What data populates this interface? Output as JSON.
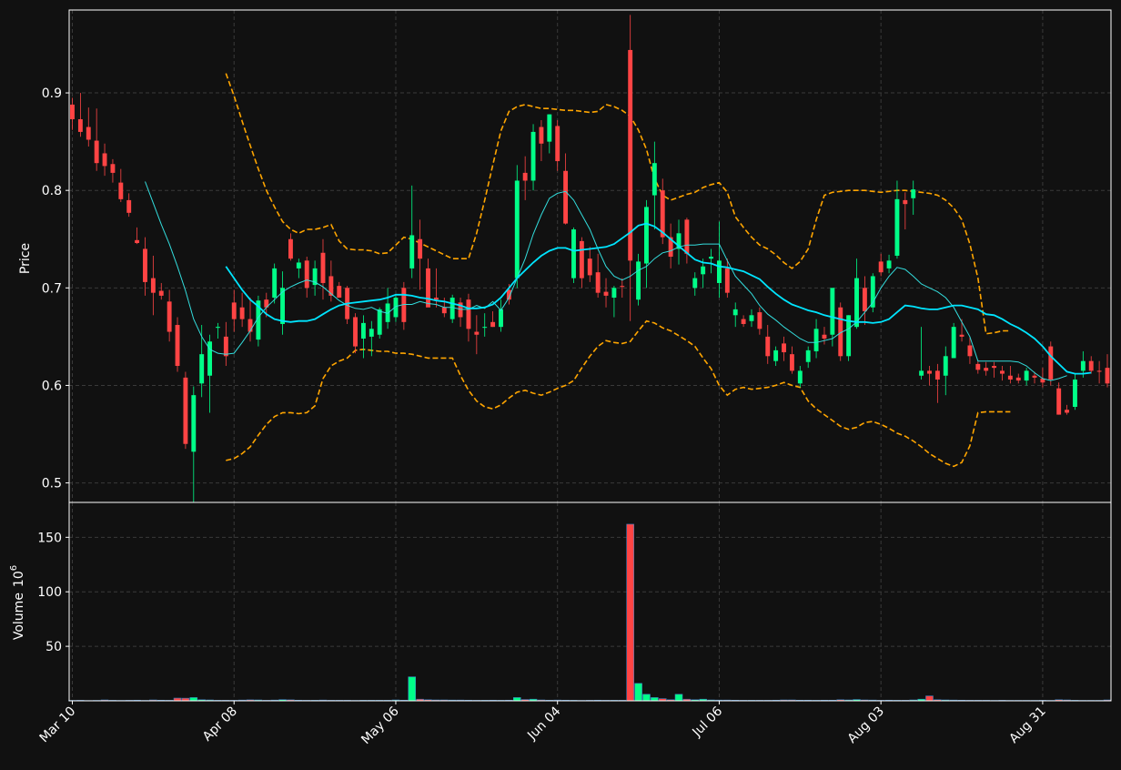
{
  "chart_data": {
    "type": "candlestick",
    "colors": {
      "background": "#111111",
      "up": "#00ff88",
      "down": "#ff4444",
      "ma_fast": "#33dddd",
      "ma_slow": "#00e5ff",
      "bands": "#ffa500",
      "grid": "#3a3a3a",
      "axes": "#ffffff",
      "volume_edge": "#3f7fbf"
    },
    "price_panel": {
      "ylabel": "Price",
      "ylim": [
        0.48,
        0.985
      ],
      "yticks": [
        0.5,
        0.6,
        0.7,
        0.8,
        0.9
      ],
      "ytick_labels": [
        "0.5",
        "0.6",
        "0.7",
        "0.8",
        "0.9"
      ],
      "grid": true
    },
    "volume_panel": {
      "ylabel": "Volume",
      "ylabel_exponent": "10",
      "ylabel_exponent_power": "6",
      "ylim": [
        0,
        182
      ],
      "yticks": [
        50,
        100,
        150
      ],
      "ytick_labels": [
        "50",
        "100",
        "150"
      ],
      "grid": true
    },
    "x_axis": {
      "tick_indices": [
        0,
        20,
        40,
        60,
        80,
        100,
        120
      ],
      "tick_labels": [
        "Mar 10",
        "Apr 08",
        "May 06",
        "Jun 04",
        "Jul 06",
        "Aug 03",
        "Aug 31"
      ]
    },
    "candles": [
      [
        0.888,
        0.895,
        0.862,
        0.873
      ],
      [
        0.873,
        0.9,
        0.855,
        0.86
      ],
      [
        0.865,
        0.885,
        0.845,
        0.852
      ],
      [
        0.851,
        0.884,
        0.82,
        0.828
      ],
      [
        0.838,
        0.848,
        0.815,
        0.825
      ],
      [
        0.827,
        0.832,
        0.808,
        0.818
      ],
      [
        0.808,
        0.822,
        0.788,
        0.791
      ],
      [
        0.79,
        0.797,
        0.773,
        0.777
      ],
      [
        0.749,
        0.762,
        0.745,
        0.746
      ],
      [
        0.74,
        0.752,
        0.692,
        0.706
      ],
      [
        0.71,
        0.733,
        0.672,
        0.695
      ],
      [
        0.697,
        0.705,
        0.688,
        0.692
      ],
      [
        0.686,
        0.698,
        0.645,
        0.655
      ],
      [
        0.662,
        0.67,
        0.614,
        0.62
      ],
      [
        0.608,
        0.614,
        0.535,
        0.54
      ],
      [
        0.532,
        0.599,
        0.48,
        0.59
      ],
      [
        0.602,
        0.662,
        0.588,
        0.632
      ],
      [
        0.61,
        0.652,
        0.572,
        0.645
      ],
      [
        0.66,
        0.664,
        0.648,
        0.66
      ],
      [
        0.65,
        0.665,
        0.62,
        0.63
      ],
      [
        0.685,
        0.698,
        0.655,
        0.668
      ],
      [
        0.68,
        0.695,
        0.66,
        0.668
      ],
      [
        0.668,
        0.69,
        0.645,
        0.655
      ],
      [
        0.647,
        0.692,
        0.64,
        0.687
      ],
      [
        0.688,
        0.695,
        0.67,
        0.68
      ],
      [
        0.69,
        0.725,
        0.684,
        0.72
      ],
      [
        0.663,
        0.717,
        0.652,
        0.7
      ],
      [
        0.75,
        0.756,
        0.728,
        0.73
      ],
      [
        0.72,
        0.73,
        0.71,
        0.726
      ],
      [
        0.728,
        0.732,
        0.69,
        0.7
      ],
      [
        0.703,
        0.728,
        0.692,
        0.72
      ],
      [
        0.736,
        0.75,
        0.688,
        0.705
      ],
      [
        0.712,
        0.728,
        0.686,
        0.692
      ],
      [
        0.702,
        0.706,
        0.694,
        0.69
      ],
      [
        0.7,
        0.702,
        0.663,
        0.668
      ],
      [
        0.67,
        0.674,
        0.633,
        0.64
      ],
      [
        0.648,
        0.672,
        0.628,
        0.664
      ],
      [
        0.65,
        0.666,
        0.63,
        0.658
      ],
      [
        0.652,
        0.68,
        0.648,
        0.678
      ],
      [
        0.665,
        0.7,
        0.658,
        0.684
      ],
      [
        0.67,
        0.692,
        0.665,
        0.69
      ],
      [
        0.7,
        0.706,
        0.657,
        0.665
      ],
      [
        0.72,
        0.805,
        0.71,
        0.754
      ],
      [
        0.75,
        0.77,
        0.698,
        0.73
      ],
      [
        0.72,
        0.73,
        0.695,
        0.68
      ],
      [
        0.69,
        0.72,
        0.68,
        0.688
      ],
      [
        0.68,
        0.69,
        0.67,
        0.674
      ],
      [
        0.668,
        0.693,
        0.664,
        0.69
      ],
      [
        0.685,
        0.69,
        0.66,
        0.67
      ],
      [
        0.688,
        0.694,
        0.645,
        0.658
      ],
      [
        0.655,
        0.672,
        0.632,
        0.652
      ],
      [
        0.66,
        0.674,
        0.65,
        0.66
      ],
      [
        0.665,
        0.676,
        0.66,
        0.66
      ],
      [
        0.66,
        0.688,
        0.655,
        0.678
      ],
      [
        0.698,
        0.704,
        0.683,
        0.688
      ],
      [
        0.71,
        0.826,
        0.7,
        0.81
      ],
      [
        0.818,
        0.835,
        0.79,
        0.81
      ],
      [
        0.81,
        0.868,
        0.8,
        0.86
      ],
      [
        0.865,
        0.872,
        0.83,
        0.848
      ],
      [
        0.85,
        0.878,
        0.838,
        0.878
      ],
      [
        0.866,
        0.872,
        0.82,
        0.83
      ],
      [
        0.82,
        0.838,
        0.765,
        0.766
      ],
      [
        0.71,
        0.762,
        0.705,
        0.76
      ],
      [
        0.748,
        0.752,
        0.7,
        0.71
      ],
      [
        0.73,
        0.742,
        0.706,
        0.713
      ],
      [
        0.716,
        0.735,
        0.69,
        0.695
      ],
      [
        0.696,
        0.71,
        0.68,
        0.692
      ],
      [
        0.69,
        0.702,
        0.67,
        0.7
      ],
      [
        0.702,
        0.71,
        0.69,
        0.701
      ],
      [
        0.944,
        0.98,
        0.666,
        0.728
      ],
      [
        0.688,
        0.735,
        0.682,
        0.727
      ],
      [
        0.725,
        0.79,
        0.7,
        0.783
      ],
      [
        0.795,
        0.85,
        0.76,
        0.828
      ],
      [
        0.8,
        0.812,
        0.745,
        0.752
      ],
      [
        0.752,
        0.766,
        0.72,
        0.732
      ],
      [
        0.74,
        0.77,
        0.724,
        0.756
      ],
      [
        0.77,
        0.772,
        0.725,
        0.735
      ],
      [
        0.7,
        0.716,
        0.692,
        0.71
      ],
      [
        0.714,
        0.73,
        0.7,
        0.722
      ],
      [
        0.73,
        0.74,
        0.715,
        0.732
      ],
      [
        0.705,
        0.768,
        0.69,
        0.728
      ],
      [
        0.72,
        0.73,
        0.69,
        0.695
      ],
      [
        0.672,
        0.685,
        0.66,
        0.678
      ],
      [
        0.668,
        0.672,
        0.66,
        0.663
      ],
      [
        0.666,
        0.678,
        0.66,
        0.672
      ],
      [
        0.675,
        0.68,
        0.652,
        0.658
      ],
      [
        0.65,
        0.662,
        0.622,
        0.63
      ],
      [
        0.625,
        0.64,
        0.62,
        0.636
      ],
      [
        0.643,
        0.65,
        0.625,
        0.634
      ],
      [
        0.632,
        0.64,
        0.612,
        0.615
      ],
      [
        0.602,
        0.62,
        0.598,
        0.615
      ],
      [
        0.624,
        0.64,
        0.618,
        0.636
      ],
      [
        0.635,
        0.668,
        0.628,
        0.658
      ],
      [
        0.652,
        0.66,
        0.642,
        0.648
      ],
      [
        0.652,
        0.7,
        0.64,
        0.7
      ],
      [
        0.68,
        0.685,
        0.625,
        0.63
      ],
      [
        0.63,
        0.672,
        0.625,
        0.672
      ],
      [
        0.66,
        0.73,
        0.658,
        0.71
      ],
      [
        0.7,
        0.712,
        0.662,
        0.676
      ],
      [
        0.68,
        0.715,
        0.675,
        0.712
      ],
      [
        0.727,
        0.735,
        0.712,
        0.716
      ],
      [
        0.72,
        0.734,
        0.715,
        0.728
      ],
      [
        0.733,
        0.81,
        0.73,
        0.791
      ],
      [
        0.79,
        0.798,
        0.76,
        0.786
      ],
      [
        0.792,
        0.81,
        0.775,
        0.801
      ],
      [
        0.61,
        0.66,
        0.606,
        0.615
      ],
      [
        0.615,
        0.62,
        0.6,
        0.612
      ],
      [
        0.615,
        0.622,
        0.582,
        0.606
      ],
      [
        0.61,
        0.64,
        0.59,
        0.63
      ],
      [
        0.628,
        0.664,
        0.628,
        0.66
      ],
      [
        0.652,
        0.668,
        0.645,
        0.65
      ],
      [
        0.641,
        0.65,
        0.622,
        0.63
      ],
      [
        0.622,
        0.626,
        0.612,
        0.616
      ],
      [
        0.618,
        0.624,
        0.61,
        0.615
      ],
      [
        0.62,
        0.624,
        0.608,
        0.618
      ],
      [
        0.615,
        0.62,
        0.605,
        0.612
      ],
      [
        0.61,
        0.62,
        0.602,
        0.606
      ],
      [
        0.608,
        0.612,
        0.602,
        0.605
      ],
      [
        0.605,
        0.618,
        0.6,
        0.615
      ],
      [
        0.61,
        0.614,
        0.602,
        0.608
      ],
      [
        0.607,
        0.618,
        0.598,
        0.603
      ],
      [
        0.64,
        0.645,
        0.6,
        0.606
      ],
      [
        0.597,
        0.603,
        0.57,
        0.57
      ],
      [
        0.575,
        0.58,
        0.57,
        0.572
      ],
      [
        0.578,
        0.612,
        0.575,
        0.606
      ],
      [
        0.615,
        0.635,
        0.608,
        0.625
      ],
      [
        0.625,
        0.63,
        0.612,
        0.615
      ],
      [
        0.615,
        0.625,
        0.602,
        0.614
      ],
      [
        0.618,
        0.632,
        0.598,
        0.602
      ]
    ],
    "volume": [
      0.4,
      0.5,
      0.3,
      0.4,
      0.8,
      0.5,
      0.4,
      0.5,
      0.6,
      0.4,
      0.8,
      0.6,
      0.5,
      2.5,
      2.4,
      3.0,
      1.0,
      0.8,
      0.5,
      0.5,
      0.5,
      0.7,
      0.9,
      0.8,
      0.5,
      0.7,
      1.1,
      0.9,
      0.6,
      0.5,
      0.5,
      0.7,
      0.5,
      0.5,
      0.5,
      0.4,
      0.5,
      0.5,
      0.5,
      0.5,
      0.8,
      0.6,
      22,
      1.5,
      1.0,
      0.8,
      0.8,
      0.7,
      0.7,
      0.6,
      0.5,
      0.5,
      0.6,
      0.5,
      0.6,
      3.0,
      1.2,
      1.5,
      0.8,
      0.6,
      0.7,
      0.6,
      0.5,
      0.4,
      0.5,
      0.6,
      0.5,
      0.5,
      0.5,
      162,
      16,
      6,
      3,
      2,
      1,
      6,
      1.5,
      1,
      1.5,
      0.8,
      0.7,
      0.7,
      0.6,
      0.5,
      0.5,
      0.5,
      0.5,
      0.6,
      0.8,
      0.8,
      0.6,
      0.6,
      0.5,
      0.6,
      0.6,
      1.0,
      0.8,
      1.2,
      0.8,
      0.7,
      0.5,
      0.6,
      0.5,
      0.5,
      0.8,
      1.5,
      4.5,
      1.0,
      0.8,
      0.7,
      0.6,
      0.5,
      0.5,
      0.5,
      0.4,
      0.5,
      0.4,
      0.4,
      0.4,
      0.4,
      0.5,
      0.4,
      1.0,
      0.8,
      0.5,
      0.4,
      0.4,
      0.4,
      0.8
    ],
    "ma_fast": {
      "start_index": 9,
      "values": [
        0.809,
        0.787,
        0.765,
        0.745,
        0.722,
        0.697,
        0.668,
        0.65,
        0.637,
        0.633,
        0.632,
        0.633,
        0.644,
        0.656,
        0.67,
        0.68,
        0.688,
        0.696,
        0.701,
        0.705,
        0.708,
        0.706,
        0.701,
        0.694,
        0.687,
        0.682,
        0.679,
        0.678,
        0.68,
        0.676,
        0.674,
        0.681,
        0.683,
        0.683,
        0.686,
        0.684,
        0.683,
        0.68,
        0.68,
        0.678,
        0.678,
        0.682,
        0.679,
        0.686,
        0.677,
        0.69,
        0.71,
        0.73,
        0.755,
        0.775,
        0.792,
        0.797,
        0.799,
        0.79,
        0.775,
        0.76,
        0.74,
        0.722,
        0.712,
        0.708,
        0.712,
        0.718,
        0.722,
        0.73,
        0.736,
        0.738,
        0.742,
        0.744,
        0.744,
        0.745,
        0.745,
        0.745,
        0.728,
        0.712,
        0.703,
        0.694,
        0.682,
        0.673,
        0.667,
        0.66,
        0.654,
        0.648,
        0.644,
        0.644,
        0.646,
        0.648,
        0.654,
        0.658,
        0.665,
        0.675,
        0.685,
        0.7,
        0.712,
        0.721,
        0.719,
        0.712,
        0.704,
        0.7,
        0.696,
        0.69,
        0.68,
        0.665,
        0.65,
        0.625,
        0.625,
        0.625,
        0.625,
        0.625,
        0.624,
        0.62,
        0.613,
        0.607,
        0.605,
        0.607,
        0.61
      ]
    },
    "ma_slow": {
      "start_index": 19,
      "values": [
        0.722,
        0.71,
        0.698,
        0.688,
        0.681,
        0.673,
        0.668,
        0.666,
        0.665,
        0.666,
        0.666,
        0.668,
        0.673,
        0.678,
        0.682,
        0.684,
        0.685,
        0.686,
        0.687,
        0.688,
        0.69,
        0.693,
        0.693,
        0.692,
        0.69,
        0.689,
        0.687,
        0.686,
        0.684,
        0.682,
        0.679,
        0.679,
        0.68,
        0.683,
        0.69,
        0.7,
        0.71,
        0.718,
        0.726,
        0.733,
        0.738,
        0.741,
        0.741,
        0.738,
        0.739,
        0.74,
        0.741,
        0.742,
        0.745,
        0.751,
        0.757,
        0.764,
        0.766,
        0.763,
        0.757,
        0.75,
        0.743,
        0.736,
        0.729,
        0.726,
        0.725,
        0.722,
        0.721,
        0.719,
        0.717,
        0.713,
        0.709,
        0.701,
        0.694,
        0.688,
        0.683,
        0.68,
        0.677,
        0.675,
        0.672,
        0.67,
        0.668,
        0.666,
        0.665,
        0.665,
        0.664,
        0.665,
        0.668,
        0.675,
        0.682,
        0.681,
        0.679,
        0.678,
        0.678,
        0.68,
        0.682,
        0.682,
        0.68,
        0.678,
        0.673,
        0.672,
        0.668,
        0.663,
        0.659,
        0.654,
        0.648,
        0.64,
        0.63,
        0.622,
        0.614,
        0.612,
        0.612,
        0.613
      ]
    },
    "bands": {
      "start_index": 19,
      "upper": [
        0.92,
        0.897,
        0.871,
        0.846,
        0.822,
        0.8,
        0.783,
        0.768,
        0.76,
        0.756,
        0.76,
        0.76,
        0.762,
        0.765,
        0.748,
        0.74,
        0.739,
        0.739,
        0.738,
        0.735,
        0.736,
        0.744,
        0.752,
        0.75,
        0.746,
        0.742,
        0.738,
        0.734,
        0.73,
        0.73,
        0.73,
        0.756,
        0.79,
        0.826,
        0.861,
        0.881,
        0.886,
        0.888,
        0.886,
        0.884,
        0.884,
        0.883,
        0.882,
        0.882,
        0.881,
        0.88,
        0.881,
        0.888,
        0.886,
        0.882,
        0.876,
        0.862,
        0.842,
        0.812,
        0.795,
        0.79,
        0.793,
        0.796,
        0.798,
        0.803,
        0.806,
        0.808,
        0.798,
        0.773,
        0.762,
        0.752,
        0.744,
        0.74,
        0.734,
        0.726,
        0.72,
        0.727,
        0.74,
        0.77,
        0.795,
        0.798,
        0.799,
        0.8,
        0.8,
        0.8,
        0.799,
        0.798,
        0.799,
        0.8,
        0.8,
        0.799,
        0.798,
        0.797,
        0.795,
        0.79,
        0.782,
        0.77,
        0.745,
        0.71,
        0.653,
        0.654,
        0.656,
        0.656
      ],
      "lower": [
        0.523,
        0.525,
        0.53,
        0.537,
        0.549,
        0.56,
        0.568,
        0.572,
        0.572,
        0.571,
        0.572,
        0.579,
        0.607,
        0.62,
        0.625,
        0.628,
        0.636,
        0.637,
        0.636,
        0.635,
        0.635,
        0.633,
        0.633,
        0.632,
        0.63,
        0.628,
        0.628,
        0.628,
        0.628,
        0.61,
        0.595,
        0.584,
        0.578,
        0.576,
        0.58,
        0.587,
        0.593,
        0.595,
        0.592,
        0.59,
        0.593,
        0.597,
        0.6,
        0.605,
        0.618,
        0.63,
        0.64,
        0.646,
        0.644,
        0.643,
        0.645,
        0.656,
        0.666,
        0.664,
        0.659,
        0.656,
        0.651,
        0.646,
        0.64,
        0.628,
        0.617,
        0.6,
        0.59,
        0.596,
        0.598,
        0.596,
        0.597,
        0.598,
        0.6,
        0.603,
        0.6,
        0.598,
        0.584,
        0.576,
        0.57,
        0.564,
        0.558,
        0.555,
        0.557,
        0.562,
        0.563,
        0.56,
        0.556,
        0.551,
        0.548,
        0.543,
        0.537,
        0.53,
        0.525,
        0.52,
        0.517,
        0.521,
        0.538,
        0.572,
        0.573,
        0.573,
        0.573,
        0.573
      ]
    }
  }
}
